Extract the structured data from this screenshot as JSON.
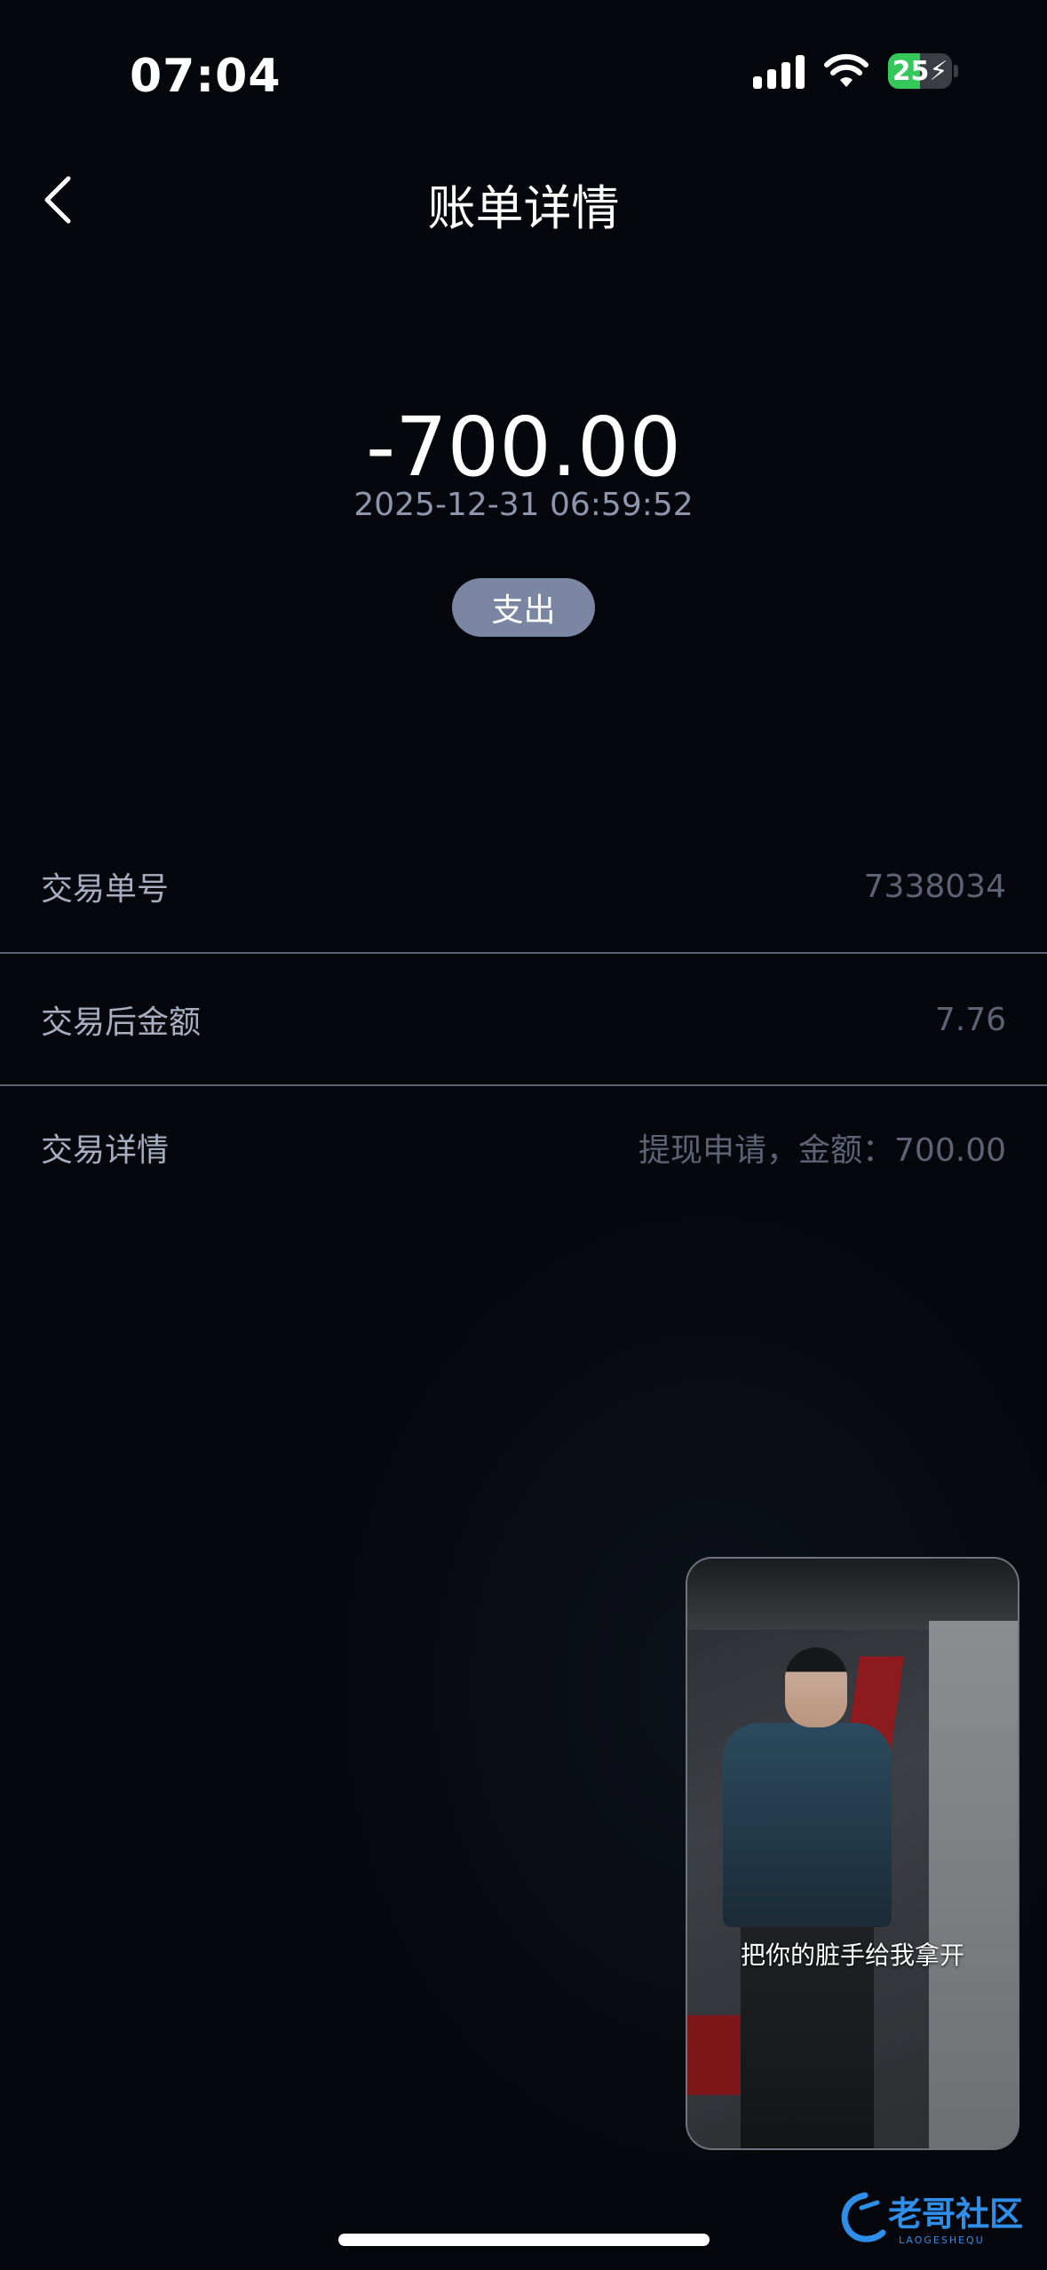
{
  "status_bar": {
    "time": "07:04",
    "battery_level": "25"
  },
  "header": {
    "title": "账单详情"
  },
  "transaction": {
    "amount": "-700.00",
    "datetime": "2025-12-31 06:59:52",
    "type_badge": "支出"
  },
  "details": [
    {
      "label": "交易单号",
      "value": "7338034"
    },
    {
      "label": "交易后金额",
      "value": "7.76"
    },
    {
      "label": "交易详情",
      "value": "提现申请，金额：700.00"
    }
  ],
  "floating_video": {
    "subtitle": "把你的脏手给我拿开"
  },
  "watermark": {
    "text": "老哥社区",
    "subtext": "LAOGESHEQU"
  },
  "colors": {
    "background": "#05070c",
    "badge": "#7b86a3",
    "battery_charging": "#34c759"
  }
}
